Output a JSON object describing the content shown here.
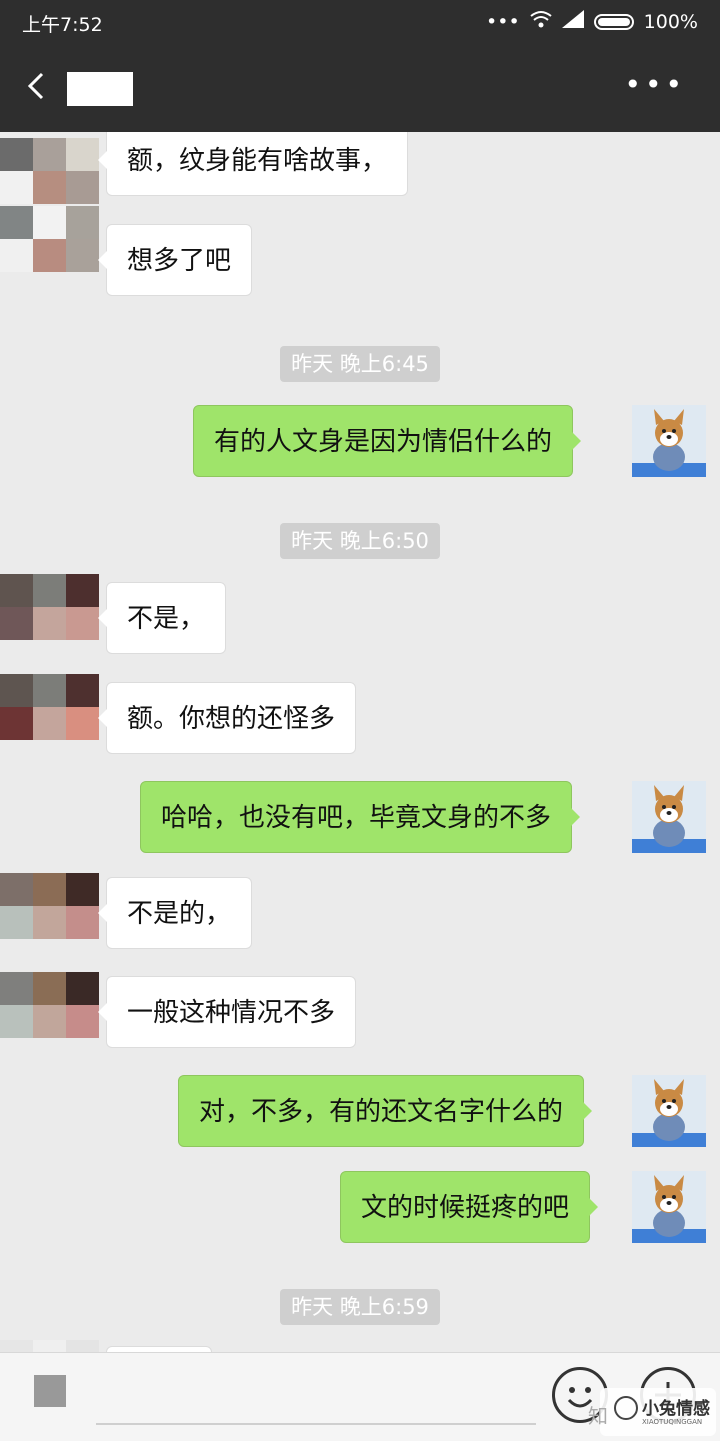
{
  "status": {
    "time": "上午7:52",
    "dots": "•••",
    "battery": "100%"
  },
  "titlebar": {
    "more": "•••"
  },
  "messages": [
    {
      "side": "left",
      "text": "额，纹身能有啥故事，"
    },
    {
      "side": "left",
      "text": "想多了吧"
    },
    {
      "timestamp": "昨天 晚上6:45"
    },
    {
      "side": "right",
      "text": "有的人文身是因为情侣什么的"
    },
    {
      "timestamp": "昨天 晚上6:50"
    },
    {
      "side": "left",
      "text": "不是，"
    },
    {
      "side": "left",
      "text": "额。你想的还怪多"
    },
    {
      "side": "right",
      "text": "哈哈，也没有吧，毕竟文身的不多"
    },
    {
      "side": "left",
      "text": "不是的，"
    },
    {
      "side": "left",
      "text": "一般这种情况不多"
    },
    {
      "side": "right",
      "text": "对，不多，有的还文名字什么的"
    },
    {
      "side": "right",
      "text": "文的时候挺疼的吧"
    },
    {
      "timestamp": "昨天 晚上6:59"
    }
  ],
  "watermark": {
    "prefix": "知",
    "text": "小兔情感",
    "sub": "XIAOTUQINGGAN"
  },
  "colors": {
    "bubble_right": "#9fe46a",
    "bubble_left": "#ffffff",
    "bar": "#2e2e2e"
  }
}
